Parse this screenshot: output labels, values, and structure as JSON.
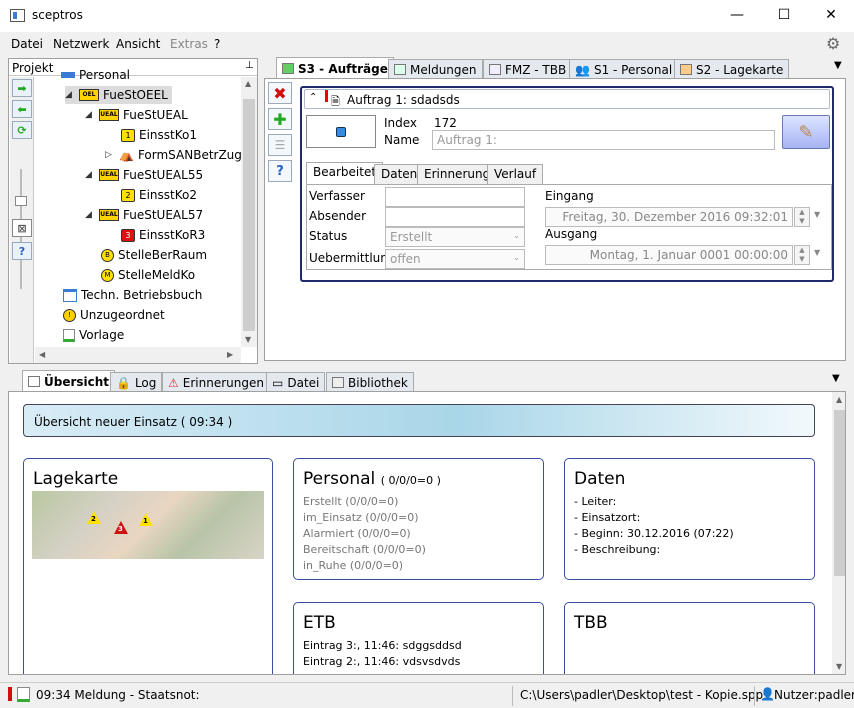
{
  "window": {
    "title": "sceptros",
    "minimize": "—",
    "maximize": "☐",
    "close": "✕"
  },
  "menu": [
    "Datei",
    "Netzwerk",
    "Ansicht",
    "Extras",
    "?"
  ],
  "project": {
    "header": "Projekt",
    "pin": "📌",
    "tree": [
      {
        "label": "Personal"
      },
      {
        "label": "FueStOEEL",
        "badge": "OEL"
      },
      {
        "label": "FueStUEAL",
        "badge": "UEAL"
      },
      {
        "label": "EinsstKo1",
        "badge": "1"
      },
      {
        "label": "FormSANBetrZug"
      },
      {
        "label": "FueStUEAL55",
        "badge": "UEAL"
      },
      {
        "label": "EinsstKo2",
        "badge": "2"
      },
      {
        "label": "FueStUEAL57",
        "badge": "UEAL"
      },
      {
        "label": "EinsstKoR3",
        "badge": "3"
      },
      {
        "label": "StelleBerRaum",
        "badge": "B"
      },
      {
        "label": "StelleMeldKo",
        "badge": "M"
      },
      {
        "label": "Techn. Betriebsbuch"
      },
      {
        "label": "Unzugeordnet"
      },
      {
        "label": "Vorlage"
      }
    ]
  },
  "top_tabs": [
    "S3 - Aufträge",
    "Meldungen",
    "FMZ - TBB",
    "S1 - Personal",
    "S2 - Lagekarte"
  ],
  "auftrag": {
    "header": "Auftrag 1:  sdadsds",
    "index_label": "Index",
    "index_value": "172",
    "name_label": "Name",
    "name_value": "Auftrag 1:",
    "subtabs": [
      "Bearbeitet",
      "Daten",
      "Erinnerung",
      "Verlauf"
    ],
    "verfasser_label": "Verfasser",
    "absender_label": "Absender",
    "status_label": "Status",
    "status_value": "Erstellt",
    "uebermittlung_label": "Uebermittlung",
    "uebermittlung_value": "offen",
    "eingang_label": "Eingang",
    "eingang_value": "Freitag, 30. Dezember 2016 09:32:01",
    "ausgang_label": "Ausgang",
    "ausgang_value": "Montag, 1. Januar 0001 00:00:00"
  },
  "bottom_tabs": [
    "Übersicht",
    "Log",
    "Erinnerungen",
    "Datei",
    "Bibliothek"
  ],
  "overview": {
    "banner": "Übersicht neuer Einsatz  ( 09:34 )",
    "lagekarte_title": "Lagekarte",
    "map_markers": [
      "2",
      "3",
      "1"
    ],
    "personal_title": "Personal",
    "personal_count": "( 0/0/0=0 )",
    "personal_lines": [
      "Erstellt (0/0/0=0)",
      "im_Einsatz (0/0/0=0)",
      "Alarmiert (0/0/0=0)",
      "Bereitschaft (0/0/0=0)",
      "in_Ruhe (0/0/0=0)"
    ],
    "daten_title": "Daten",
    "daten_lines": [
      "- Leiter:",
      "- Einsatzort:",
      "- Beginn:  30.12.2016 (07:22)",
      "- Beschreibung:"
    ],
    "etb_title": "ETB",
    "etb_lines": [
      "Eintrag 3:, 11:46: sdggsddsd",
      "Eintrag 2:, 11:46: vdsvsdvds"
    ],
    "tbb_title": "TBB"
  },
  "status": {
    "message": "09:34 Meldung - Staatsnot:",
    "path": "C:\\Users\\padler\\Desktop\\test - Kopie.spp*",
    "user": "Nutzer:padler"
  }
}
